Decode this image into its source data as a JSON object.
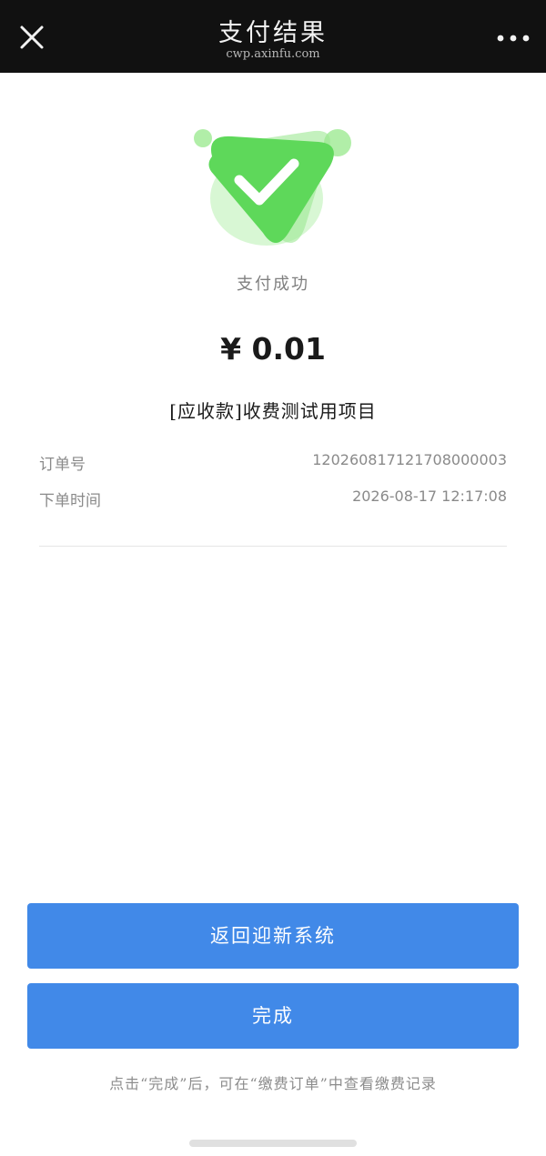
{
  "header": {
    "title": "支付结果",
    "domain": "cwp.axinfu.com"
  },
  "icons": {
    "close": "close-icon",
    "more": "more-dots-icon",
    "success": "success-check-icon"
  },
  "colors": {
    "header_bg": "#111111",
    "success_green": "#5ed85a",
    "button_blue": "#4189e8"
  },
  "result": {
    "status": "支付成功",
    "amount": "¥ 0.01",
    "item_name": "[应收款]收费测试用项目"
  },
  "details": [
    {
      "label": "订单号",
      "value": "120260817121708000003"
    },
    {
      "label": "下单时间",
      "value": "2026-08-17 12:17:08"
    }
  ],
  "buttons": {
    "return_label": "返回迎新系统",
    "done_label": "完成"
  },
  "hint": "点击“完成”后，可在“缴费订单”中查看缴费记录"
}
